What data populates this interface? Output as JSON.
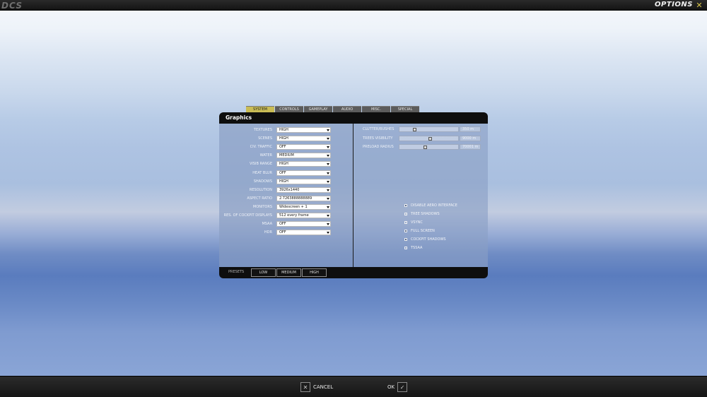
{
  "topbar": {
    "logo": "DCS",
    "title": "OPTIONS",
    "close_label": "✕"
  },
  "tabs": [
    {
      "label": "SYSTEM",
      "active": true
    },
    {
      "label": "CONTROLS"
    },
    {
      "label": "GAMEPLAY"
    },
    {
      "label": "AUDIO"
    },
    {
      "label": "MISC."
    },
    {
      "label": "SPECIAL"
    }
  ],
  "panel": {
    "title": "Graphics"
  },
  "settings": [
    {
      "label": "TEXTURES",
      "value": "HIGH"
    },
    {
      "label": "SCENES",
      "value": "HIGH"
    },
    {
      "label": "CIV. TRAFFIC",
      "value": "OFF"
    },
    {
      "label": "WATER",
      "value": "MEDIUM"
    },
    {
      "label": "VISIB RANGE",
      "value": "HIGH"
    },
    {
      "label": "HEAT BLUR",
      "value": "OFF"
    },
    {
      "label": "SHADOWS",
      "value": "HIGH"
    },
    {
      "label": "RESOLUTION",
      "value": "3926x1440"
    },
    {
      "label": "ASPECT RATIO",
      "value": "2.7263888888889"
    },
    {
      "label": "MONITORS",
      "value": "Widescreen + 1"
    },
    {
      "label": "RES. OF COCKPIT DISPLAYS",
      "value": "512 every frame"
    },
    {
      "label": "MSAA",
      "value": "OFF"
    },
    {
      "label": "HDR",
      "value": "OFF"
    }
  ],
  "sliders": [
    {
      "label": "CLUTTER/BUSHES",
      "value": "350 m",
      "level": 0.24
    },
    {
      "label": "TREES VISIBILITY",
      "value": "9000 m",
      "level": 0.52
    },
    {
      "label": "PRELOAD RADIUS",
      "value": "70001 m",
      "level": 0.44
    }
  ],
  "checkboxes": [
    {
      "label": "DISABLE AERO INTERFACE",
      "checked": true
    },
    {
      "label": "TREE SHADOWS",
      "checked": false
    },
    {
      "label": "VSYNC",
      "checked": false
    },
    {
      "label": "FULL SCREEN",
      "checked": true
    },
    {
      "label": "COCKPIT SHADOWS",
      "checked": true
    },
    {
      "label": "TSSAA",
      "checked": false
    }
  ],
  "presets": {
    "label": "PRESETS",
    "buttons": [
      "LOW",
      "MEDIUM",
      "HIGH"
    ]
  },
  "bottombar": {
    "cancel_label": "CANCEL",
    "cancel_icon": "✕",
    "ok_label": "OK",
    "ok_icon": "✓"
  }
}
